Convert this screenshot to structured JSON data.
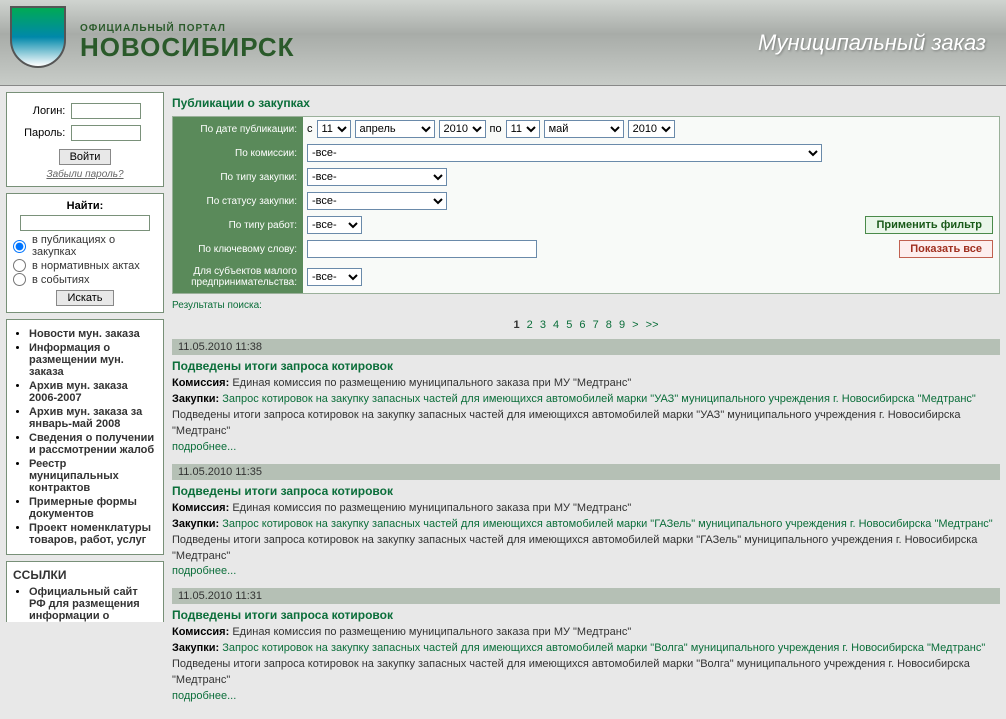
{
  "header": {
    "portal_label": "ОФИЦИАЛЬНЫЙ ПОРТАЛ",
    "city": "НОВОСИБИРСК",
    "slogan": "Муниципальный заказ"
  },
  "login": {
    "login_label": "Логин:",
    "pass_label": "Пароль:",
    "submit": "Войти",
    "forgot": "Забыли пароль?"
  },
  "search": {
    "title": "Найти:",
    "opt_pub": "в публикациях о закупках",
    "opt_norm": "в нормативных актах",
    "opt_event": "в событиях",
    "submit": "Искать"
  },
  "nav": {
    "items": [
      "Новости мун. заказа",
      "Информация о размещении мун. заказа",
      "Архив мун. заказа 2006-2007",
      "Архив мун. заказа за январь-май 2008",
      "Сведения о получении и рассмотрении жалоб",
      "Реестр муниципальных контрактов",
      "Примерные формы документов",
      "Проект номенклатуры товаров, работ, услуг"
    ]
  },
  "links_box": {
    "title": "ССЫЛКИ",
    "items": [
      "Официальный сайт РФ для размещения информации о"
    ]
  },
  "main": {
    "title": "Публикации о закупках",
    "filters": {
      "date_label": "По дате публикации:",
      "date_from_prefix": "с",
      "date_to_prefix": "по",
      "day_from": "11",
      "month_from": "апрель",
      "year_from": "2010",
      "day_to": "11",
      "month_to": "май",
      "year_to": "2010",
      "commission_label": "По комиссии:",
      "commission_value": "-все-",
      "ptype_label": "По типу закупки:",
      "ptype_value": "-все-",
      "status_label": "По статусу закупки:",
      "status_value": "-все-",
      "work_label": "По типу работ:",
      "work_value": "-все-",
      "keyword_label": "По ключевому слову:",
      "sme_label": "Для субъектов малого предпринимательства:",
      "sme_value": "-все-",
      "apply": "Применить фильтр",
      "show_all": "Показать все"
    },
    "results_label": "Результаты поиска:",
    "pager": {
      "pages": [
        "1",
        "2",
        "3",
        "4",
        "5",
        "6",
        "7",
        "8",
        "9"
      ],
      "next": ">",
      "last": ">>"
    },
    "results": [
      {
        "ts": "11.05.2010 11:38",
        "title": "Подведены итоги запроса котировок",
        "commission_label": "Комиссия:",
        "commission": "Единая комиссия по размещению муниципального заказа при МУ \"Медтранс\"",
        "purchase_label": "Закупки:",
        "purchase": "Запрос котировок на закупку запасных частей для имеющихся автомобилей марки \"УАЗ\" муниципального учреждения г. Новосибирска \"Медтранс\"",
        "desc": "Подведены итоги запроса котировок на закупку запасных частей для имеющихся автомобилей марки \"УАЗ\" муниципального учреждения г. Новосибирска \"Медтранс\"",
        "more": "подробнее..."
      },
      {
        "ts": "11.05.2010 11:35",
        "title": "Подведены итоги запроса котировок",
        "commission_label": "Комиссия:",
        "commission": "Единая комиссия по размещению муниципального заказа при МУ \"Медтранс\"",
        "purchase_label": "Закупки:",
        "purchase": "Запрос котировок на закупку запасных частей для имеющихся автомобилей марки \"ГАЗель\" муниципального учреждения г. Новосибирска \"Медтранс\"",
        "desc": "Подведены итоги запроса котировок на закупку запасных частей для имеющихся автомобилей марки \"ГАЗель\" муниципального учреждения г. Новосибирска \"Медтранс\"",
        "more": "подробнее..."
      },
      {
        "ts": "11.05.2010 11:31",
        "title": "Подведены итоги запроса котировок",
        "commission_label": "Комиссия:",
        "commission": "Единая комиссия по размещению муниципального заказа при МУ \"Медтранс\"",
        "purchase_label": "Закупки:",
        "purchase": "Запрос котировок на закупку запасных частей для имеющихся автомобилей марки \"Волга\" муниципального учреждения г. Новосибирска \"Медтранс\"",
        "desc": "Подведены итоги запроса котировок на закупку запасных частей для имеющихся автомобилей марки \"Волга\" муниципального учреждения г. Новосибирска \"Медтранс\"",
        "more": "подробнее..."
      }
    ]
  }
}
